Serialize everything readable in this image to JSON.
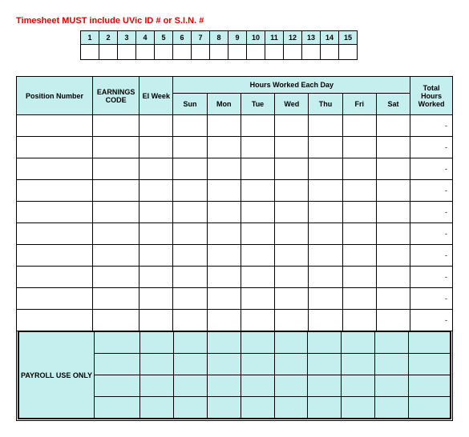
{
  "notice": "Timesheet MUST include UVic ID # or S.I.N. #",
  "id_numbers": [
    "1",
    "2",
    "3",
    "4",
    "5",
    "6",
    "7",
    "8",
    "9",
    "10",
    "11",
    "12",
    "13",
    "14",
    "15"
  ],
  "headers": {
    "position": "Position Number",
    "earnings": "EARNINGS CODE",
    "eiweek": "EI Week",
    "hours_group": "Hours Worked Each Day",
    "days": [
      "Sun",
      "Mon",
      "Tue",
      "Wed",
      "Thu",
      "Fri",
      "Sat"
    ],
    "total": "Total Hours Worked"
  },
  "rows": [
    {
      "total": "-"
    },
    {
      "total": "-"
    },
    {
      "total": "-"
    },
    {
      "total": "-"
    },
    {
      "total": "-"
    },
    {
      "total": "-"
    },
    {
      "total": "-"
    },
    {
      "total": "-"
    },
    {
      "total": "-"
    },
    {
      "total": "-"
    }
  ],
  "payroll_label": "PAYROLL USE ONLY",
  "payroll_rows": 4
}
